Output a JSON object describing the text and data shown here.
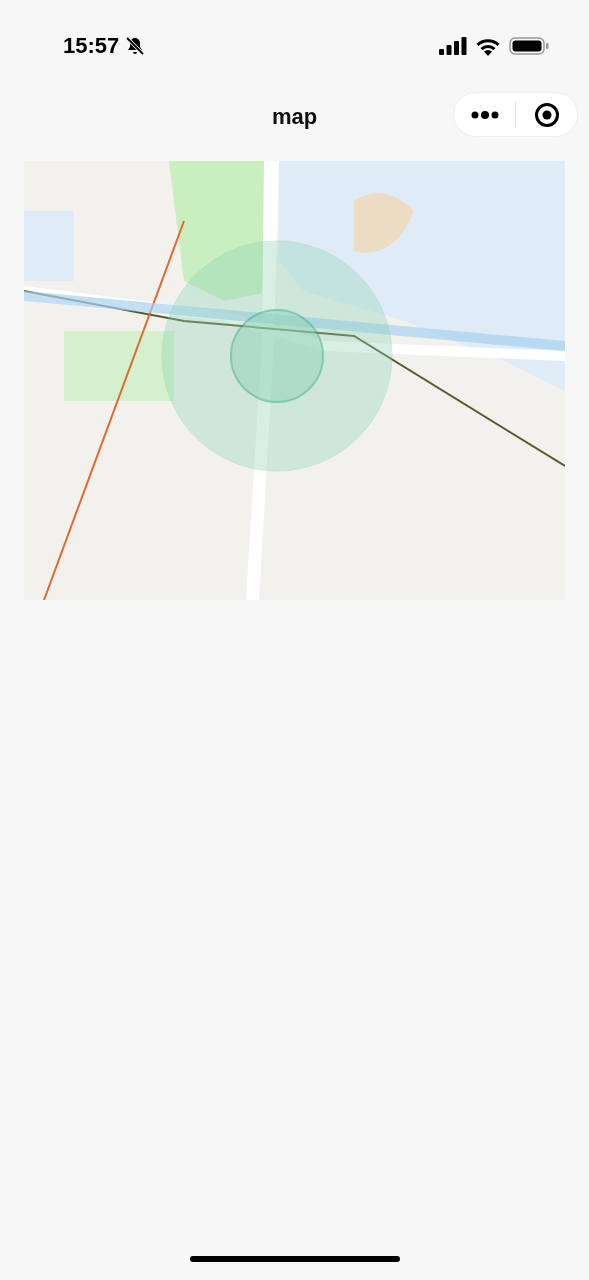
{
  "status_bar": {
    "time": "15:57",
    "muted": true
  },
  "nav": {
    "title": "map"
  }
}
